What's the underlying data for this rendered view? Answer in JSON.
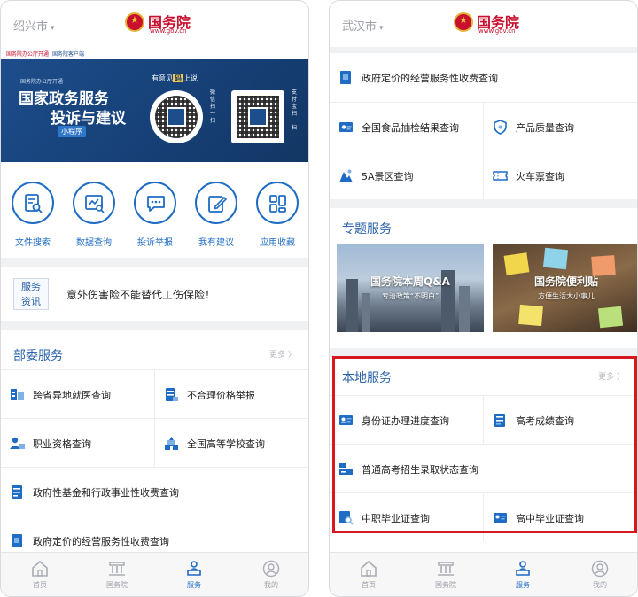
{
  "left": {
    "city": "绍兴市",
    "brand": {
      "name": "国务院",
      "url": "www.gov.cn"
    },
    "banner": {
      "mini_left": "国务院办公厅开通",
      "mini_right": "国务院客户端",
      "caption": "国务院办公厅开通",
      "title_line1": "国家政务服务",
      "title_line2": "投诉与建议",
      "tag": "小程序",
      "slogan_pre": "有意见",
      "slogan_key": "码",
      "slogan_post": "上说",
      "vertical_a": "微信扫一扫",
      "vertical_b": "支付宝扫一扫"
    },
    "quick": [
      {
        "label": "文件搜索",
        "icon": "document-search-icon"
      },
      {
        "label": "数据查询",
        "icon": "chart-search-icon"
      },
      {
        "label": "投诉举报",
        "icon": "chat-bubble-icon"
      },
      {
        "label": "我有建议",
        "icon": "edit-icon"
      },
      {
        "label": "应用收藏",
        "icon": "apps-grid-icon"
      }
    ],
    "news": {
      "tag_line1": "服务",
      "tag_line2": "资讯",
      "text": "意外伤害险不能替代工伤保险！"
    },
    "ministry": {
      "title": "部委服务",
      "more": "更多 〉",
      "items": [
        "跨省异地就医查询",
        "不合理价格举报",
        "职业资格查询",
        "全国高等学校查询",
        "政府性基金和行政事业性收费查询",
        "政府定价的经营服务性收费查询"
      ]
    },
    "tabs": [
      "首页",
      "国务院",
      "服务",
      "我的"
    ]
  },
  "right": {
    "city": "武汉市",
    "top_items": [
      "政府定价的经营服务性收费查询",
      "全国食品抽检结果查询",
      "产品质量查询",
      "5A景区查询",
      "火车票查询"
    ],
    "special": {
      "title": "专题服务",
      "card_a_title": "国务院本周Q&A",
      "card_a_sub": "专治政策“不明白”",
      "card_b_title": "国务院便利贴",
      "card_b_sub": "方便生活大小事儿"
    },
    "local": {
      "title": "本地服务",
      "more": "更多 〉",
      "items": [
        "身份证办理进度查询",
        "高考成绩查询",
        "普通高考招生录取状态查询",
        "中职毕业证查询",
        "高中毕业证查询"
      ]
    },
    "tabs": [
      "首页",
      "国务院",
      "服务",
      "我的"
    ]
  },
  "colors": {
    "accent": "#1f6cc4",
    "brand_red": "#c8102e",
    "highlight_box": "#d7191f"
  }
}
